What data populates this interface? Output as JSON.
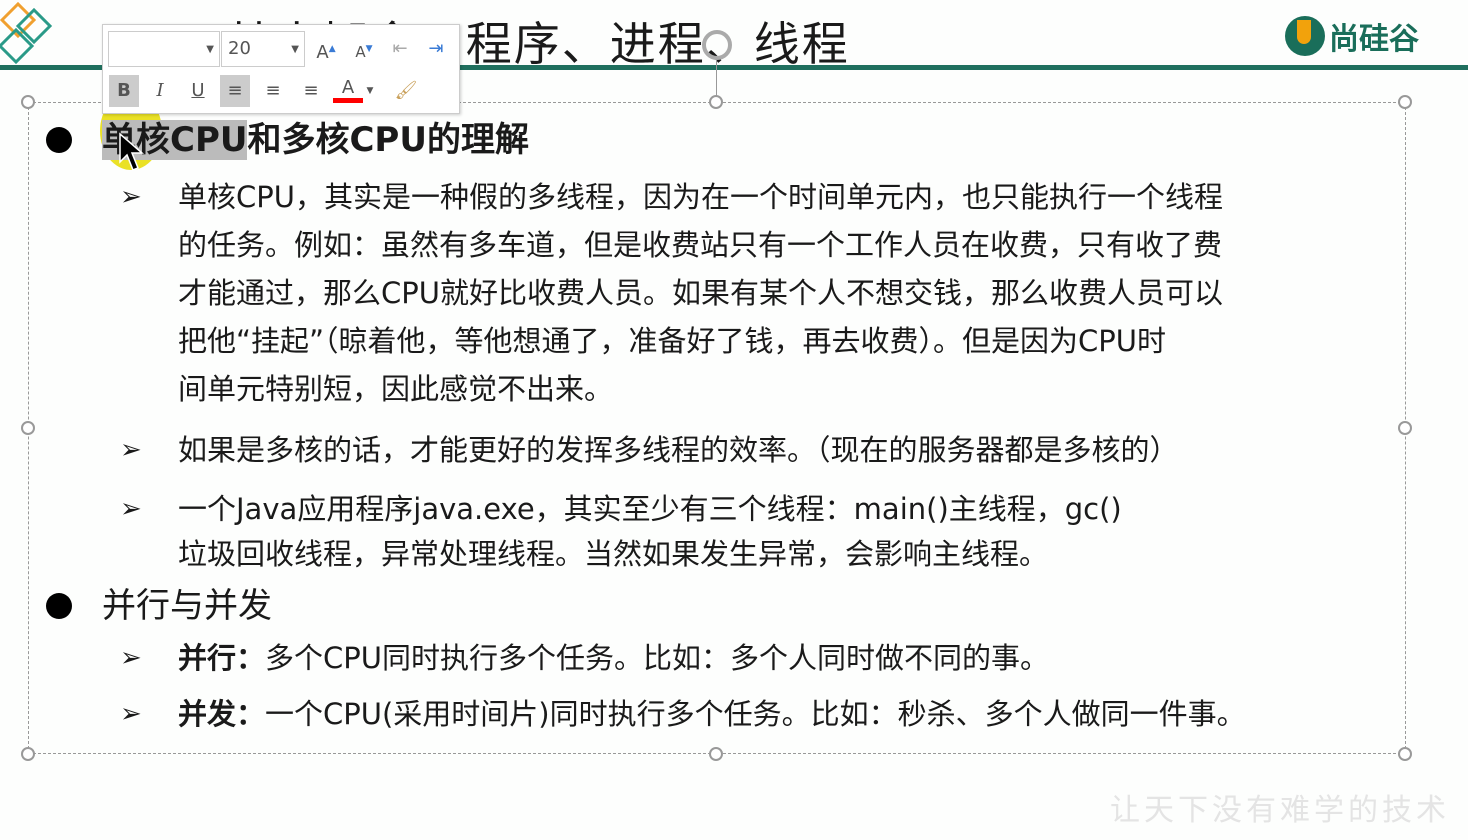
{
  "header": {
    "title": "2.1 基本概念：程序、进程、线程",
    "logo_text": "尚硅谷"
  },
  "toolbar": {
    "font_name": "",
    "font_size": "20",
    "grow": "A",
    "shrink": "A",
    "bold": "B",
    "italic": "I",
    "underline": "U",
    "font_color": "A",
    "font_color_swatch": "#ff0000"
  },
  "sections": [
    {
      "heading_hl": "单核CPU",
      "heading_rest": "和多核CPU的理解",
      "items": [
        {
          "lines": [
            "单核CPU，其实是一种假的多线程，因为在一个时间单元内，也只能执行一个线程",
            "的任务。例如：虽然有多车道，但是收费站只有一个工作人员在收费，只有收了费",
            "才能通过，那么CPU就好比收费人员。如果有某个人不想交钱，那么收费人员可以",
            "把他“挂起”（晾着他，等他想通了，准备好了钱，再去收费）。但是因为CPU时",
            "间单元特别短，因此感觉不出来。"
          ]
        },
        {
          "lines": [
            "如果是多核的话，才能更好的发挥多线程的效率。（现在的服务器都是多核的）"
          ]
        },
        {
          "lines": [
            "一个Java应用程序java.exe，其实至少有三个线程：main()主线程，gc()",
            "垃圾回收线程，异常处理线程。当然如果发生异常，会影响主线程。"
          ]
        }
      ]
    },
    {
      "heading": "并行与并发",
      "items": [
        {
          "bold": "并行：",
          "text": "多个CPU同时执行多个任务。比如：多个人同时做不同的事。"
        },
        {
          "bold": "并发：",
          "text": "一个CPU(采用时间片)同时执行多个任务。比如：秒杀、多个人做同一件事。"
        }
      ]
    }
  ],
  "watermark": "让天下没有难学的技术",
  "colors": {
    "accent": "#1f6f5e",
    "logo_orange": "#f2a20c",
    "highlight": "#e6dc00"
  }
}
